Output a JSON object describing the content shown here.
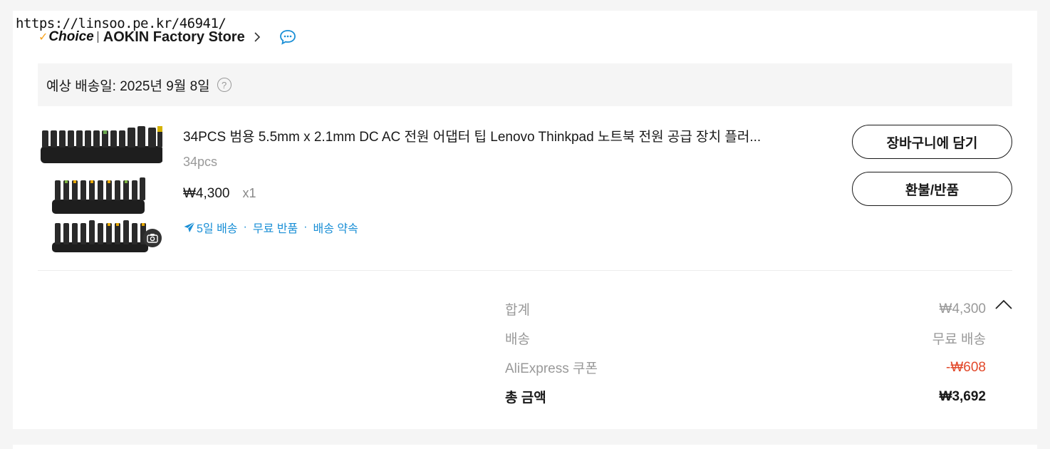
{
  "watermark": "https://linsoo.pe.kr/46941/",
  "store": {
    "badge": "Choice",
    "badge_check": "✓",
    "name": "AOKIN Factory Store"
  },
  "eta": {
    "label": "예상 배송일: 2025년 9월 8일",
    "help": "?"
  },
  "product": {
    "title": "34PCS 범용 5.5mm x 2.1mm DC AC 전원 어댑터 팁 Lenovo Thinkpad 노트북 전원 공급 장치 플러...",
    "variant": "34pcs",
    "price": "₩4,300",
    "quantity": "x1",
    "shipping": [
      "5일 배송",
      "무료 반품",
      "배송 약속"
    ],
    "shipping_sep": "·"
  },
  "actions": {
    "add_to_cart": "장바구니에 담기",
    "refund": "환불/반품"
  },
  "summary": {
    "subtotal_label": "합계",
    "subtotal_value": "₩4,300",
    "shipping_label": "배송",
    "shipping_value": "무료 배송",
    "coupon_label": "AliExpress 쿠폰",
    "coupon_value": "-₩608",
    "total_label": "총 금액",
    "total_value": "₩3,692"
  },
  "colors": {
    "link_blue": "#1a8fd6",
    "discount_red": "#e2492b",
    "choice_gold": "#f7a21b"
  }
}
